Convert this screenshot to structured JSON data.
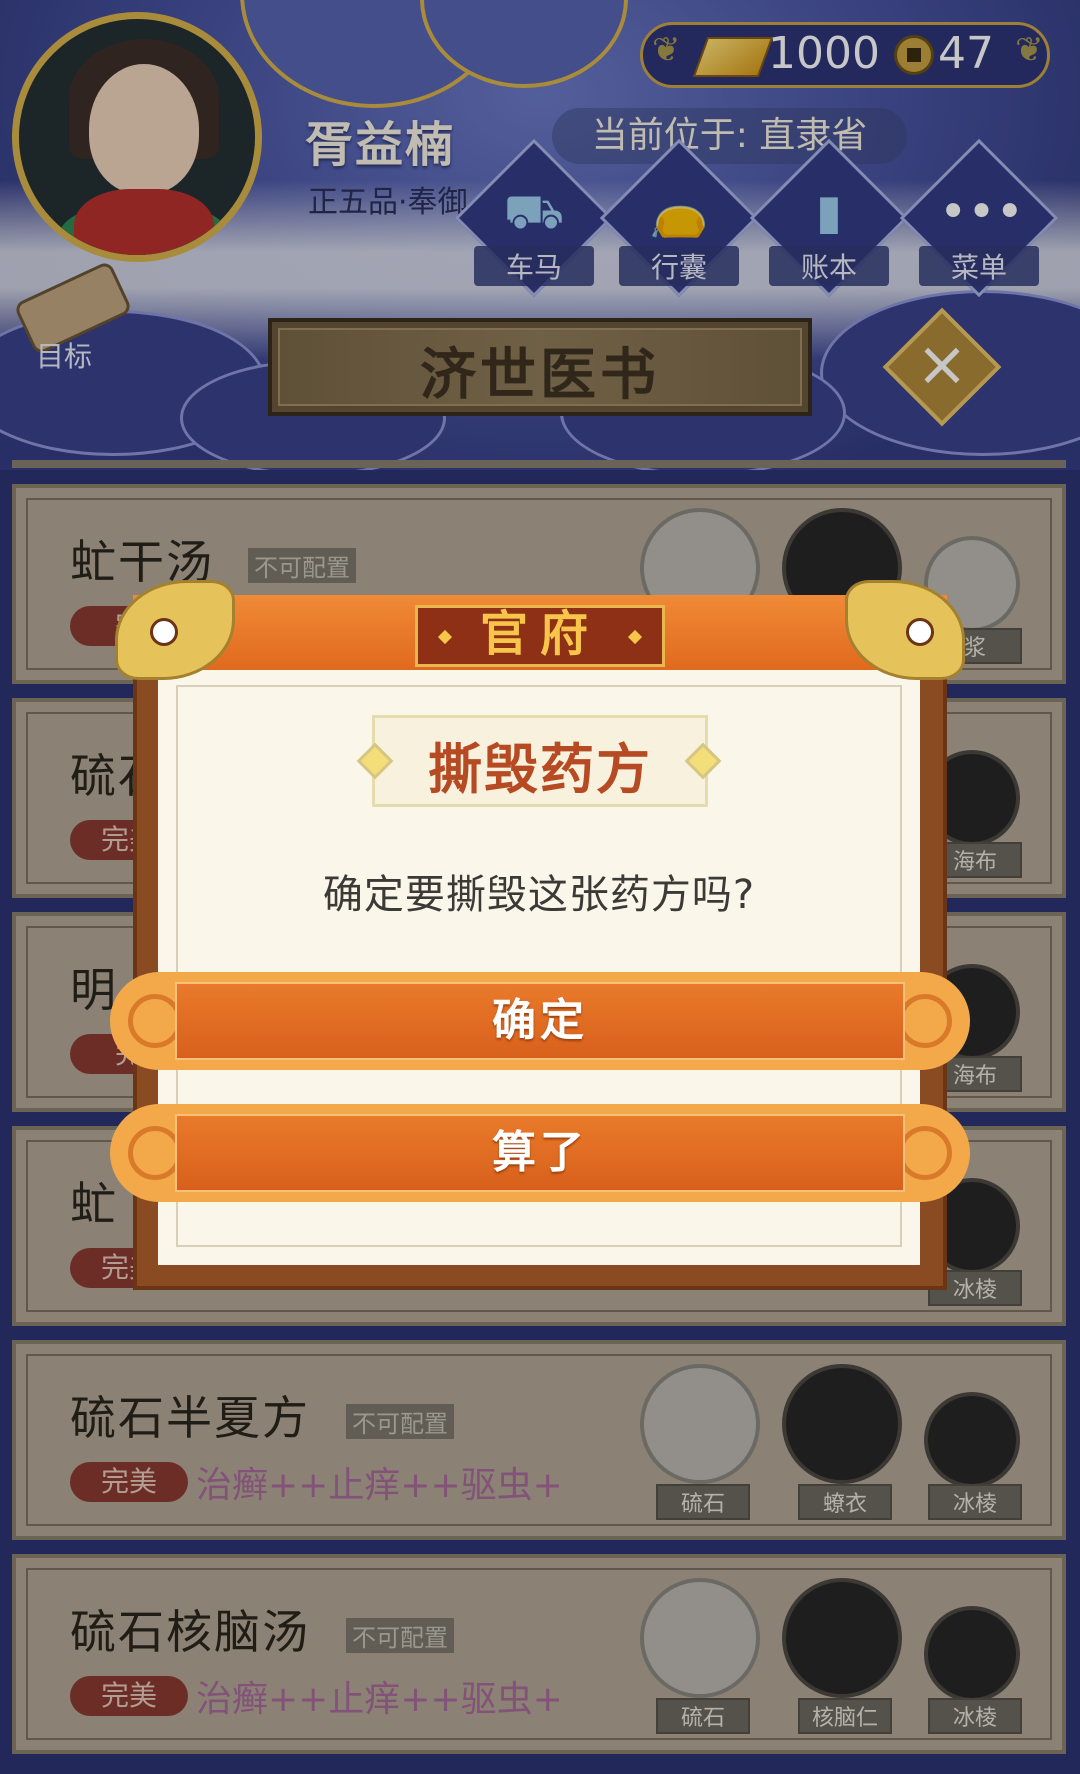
{
  "player": {
    "name": "胥益楠",
    "rank": "正五品·奉御",
    "gold": "1000",
    "coins": "47",
    "location_label": "当前位于:",
    "location": "直隶省"
  },
  "nav": [
    {
      "label": "车马",
      "icon": "carriage-icon"
    },
    {
      "label": "行囊",
      "icon": "bag-icon"
    },
    {
      "label": "账本",
      "icon": "ledger-icon"
    },
    {
      "label": "菜单",
      "icon": "menu-icon"
    }
  ],
  "goal_label": "目标",
  "page_title": "济世医书",
  "recipes": [
    {
      "name": "虻干汤",
      "tag": "不可配置",
      "badge": "完",
      "effects": "",
      "ingredients": [
        "",
        "",
        "浆"
      ]
    },
    {
      "name": "硫石",
      "tag": "",
      "badge": "完美",
      "effects": "",
      "ingredients": [
        "海布"
      ]
    },
    {
      "name": "明",
      "tag": "",
      "badge": "完",
      "effects": "",
      "ingredients": [
        "海布"
      ]
    },
    {
      "name": "虻",
      "tag": "",
      "badge": "完美",
      "effects": "",
      "ingredients": [
        "冰棱"
      ]
    },
    {
      "name": "硫石半夏方",
      "tag": "不可配置",
      "badge": "完美",
      "effects": "治癣++止痒++驱虫+",
      "ingredients": [
        "硫石",
        "蟟衣",
        "冰棱"
      ]
    },
    {
      "name": "硫石核脑汤",
      "tag": "不可配置",
      "badge": "完美",
      "effects": "治癣++止痒++驱虫+",
      "ingredients": [
        "硫石",
        "核脑仁",
        "冰棱"
      ]
    }
  ],
  "dialog": {
    "header": "官府",
    "title": "撕毁药方",
    "message": "确定要撕毁这张药方吗?",
    "confirm_label": "确定",
    "cancel_label": "算了"
  },
  "colors": {
    "accent_orange": "#e06a1e",
    "header_blue": "#4a55a3",
    "gold_trim": "#d9b44c"
  }
}
